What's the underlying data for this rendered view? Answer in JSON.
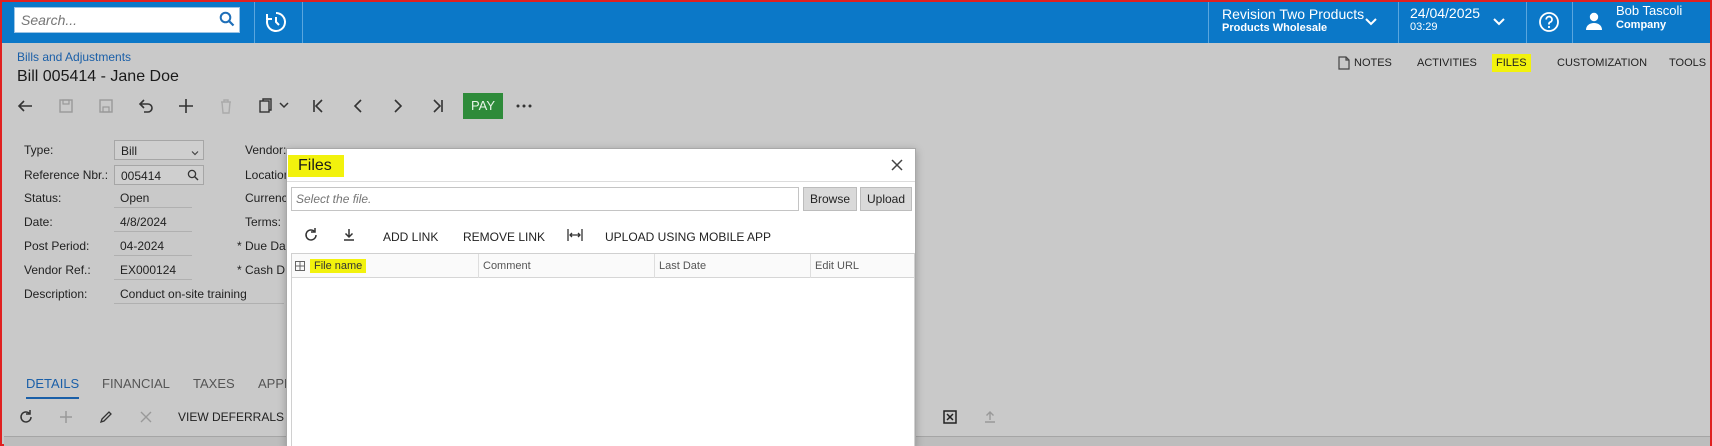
{
  "topbar": {
    "search_placeholder": "Search...",
    "company_name": "Revision Two Products",
    "company_branch": "Products Wholesale",
    "date": "24/04/2025",
    "time": "03:29",
    "user_name": "Bob Tascoli",
    "user_org": "Company",
    "icons": [
      "search-icon",
      "history-icon",
      "chevron-down-icon",
      "help-icon",
      "user-icon"
    ]
  },
  "header": {
    "breadcrumb": "Bills and Adjustments",
    "title": "Bill 005414 - Jane Doe",
    "right_tools": [
      "NOTES",
      "ACTIVITIES",
      "FILES",
      "CUSTOMIZATION",
      "TOOLS"
    ],
    "highlighted_tool": "FILES",
    "pay_label": "PAY"
  },
  "form": {
    "type_label": "Type:",
    "type_value": "Bill",
    "ref_label": "Reference Nbr.:",
    "ref_value": "005414",
    "status_label": "Status:",
    "status_value": "Open",
    "date_label": "Date:",
    "date_value": "4/8/2024",
    "post_period_label": "Post Period:",
    "post_period_value": "04-2024",
    "vendor_ref_label": "Vendor Ref.:",
    "vendor_ref_value": "EX000124",
    "description_label": "Description:",
    "description_value": "Conduct on-site training",
    "vendor_label": "Vendor:",
    "location_label": "Location",
    "currency_label": "Currenc",
    "terms_label": "Terms:",
    "due_date_label": "* Due Da",
    "cash_discount_label": "* Cash D"
  },
  "tabs": {
    "items": [
      "DETAILS",
      "FINANCIAL",
      "TAXES",
      "APPR"
    ],
    "active": "DETAILS",
    "view_deferrals": "VIEW DEFERRALS"
  },
  "dialog": {
    "title": "Files",
    "file_placeholder": "Select the file.",
    "browse": "Browse",
    "upload": "Upload",
    "add_link": "ADD LINK",
    "remove_link": "REMOVE LINK",
    "upload_mobile": "UPLOAD USING MOBILE APP",
    "columns": [
      "File name",
      "Comment",
      "Last Date",
      "Edit URL"
    ]
  },
  "colors": {
    "topbar": "#0b78c8",
    "highlight": "#f2f20d",
    "pay_button": "#2e8b3a",
    "link": "#1a5fa8"
  }
}
